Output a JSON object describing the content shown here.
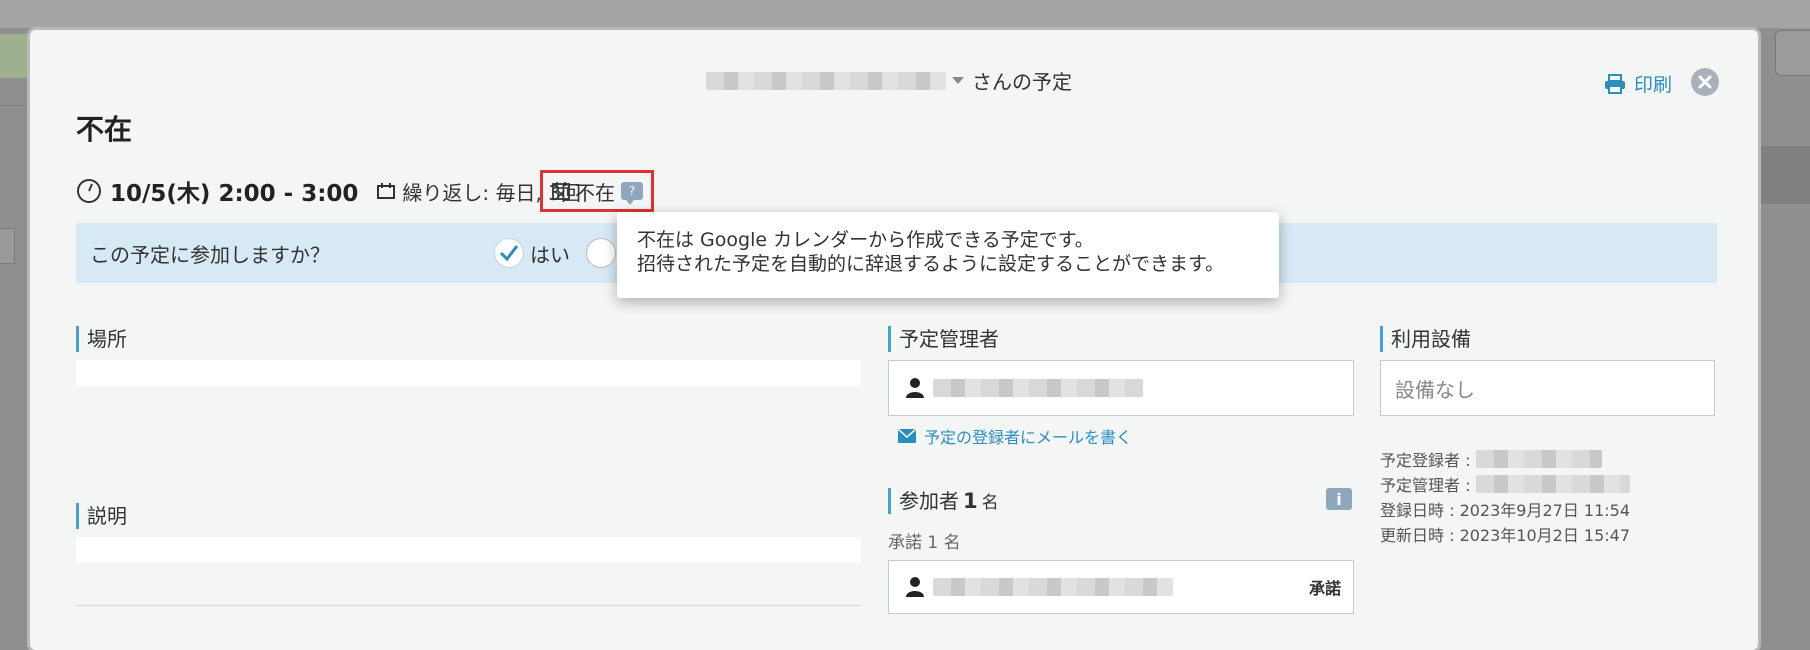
{
  "header": {
    "owner_suffix": "さんの予定",
    "print_label": "印刷"
  },
  "event": {
    "title": "不在",
    "time": "10/5(木) 2:00 - 3:00",
    "repeat": "繰り返し: 毎日, 3回",
    "type_badge": "不在"
  },
  "rsvp": {
    "question": "この予定に参加しますか？",
    "yes_label": "はい"
  },
  "tooltip": {
    "line1": "不在は Google カレンダーから作成できる予定です。",
    "line2": "招待された予定を自動的に辞退するように設定することができます。"
  },
  "sections": {
    "location_label": "場所",
    "description_label": "説明",
    "organizer_label": "予定管理者",
    "mail_link": "予定の登録者にメールを書く",
    "participants_prefix": "参加者",
    "participants_count": "1",
    "participants_suffix": "名",
    "accepted_summary": "承諾 1 名",
    "accepted_status": "承諾",
    "equipment_label": "利用設備",
    "equipment_value": "設備なし"
  },
  "meta": {
    "registered_by_label": "予定登録者 :",
    "managed_by_label": "予定管理者 :",
    "created_at": "登録日時 : 2023年9月27日 11:54",
    "updated_at": "更新日時 : 2023年10月2日 15:47"
  },
  "colors": {
    "accent": "#2a8fbf",
    "highlight_border": "#e03131",
    "rsvp_bg": "#d6e9f4"
  }
}
